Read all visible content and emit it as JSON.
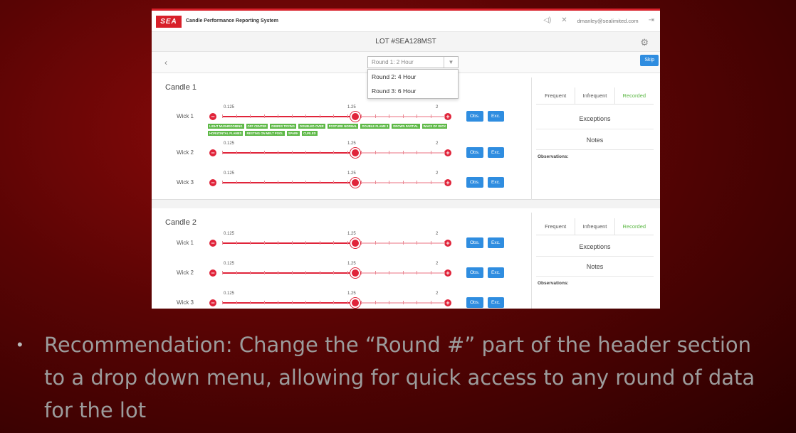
{
  "app": {
    "logo": "SEA",
    "name": "Candle Performance Reporting System",
    "user_email": "dmanley@sealimited.com"
  },
  "lot": {
    "title": "LOT #SEA128MST",
    "skip_label": "Skip"
  },
  "round_select": {
    "selected": "Round 1: 2 Hour",
    "options": [
      "Round 2: 4 Hour",
      "Round 3: 6 Hour"
    ]
  },
  "scale": {
    "min": "0.125",
    "mid": "1.25",
    "max": "2"
  },
  "buttons": {
    "obs": "Obs.",
    "exc": "Exc."
  },
  "candles": [
    {
      "title": "Candle 1",
      "wicks": [
        {
          "label": "Wick 1",
          "value": 1.25
        },
        {
          "label": "Wick 2",
          "value": 1.25
        },
        {
          "label": "Wick 3",
          "value": 1.25
        }
      ],
      "tags": [
        "LIGHT MUSHROOMING",
        "OFF CENTER",
        "DEBRIS TRYING",
        "DOUBLED OVER",
        "POSTURE NORMAL",
        "DOUBLE FLAME 3",
        "DROWN PARTIAL",
        "WAKS OF WICK",
        "HORIZONTAL FLAMES",
        "RESTING ON MELT POOL",
        "SPARK",
        "CURLED"
      ],
      "tabs": [
        "Frequent",
        "Infrequent",
        "Recorded"
      ],
      "exceptions_label": "Exceptions",
      "notes_label": "Notes",
      "observations_label": "Observations:"
    },
    {
      "title": "Candle 2",
      "wicks": [
        {
          "label": "Wick 1",
          "value": 1.25
        },
        {
          "label": "Wick 2",
          "value": 1.25
        },
        {
          "label": "Wick 3",
          "value": 1.25
        }
      ],
      "tabs": [
        "Frequent",
        "Infrequent",
        "Recorded"
      ],
      "exceptions_label": "Exceptions",
      "notes_label": "Notes",
      "observations_label": "Observations:"
    }
  ],
  "slide": {
    "bullet": "•",
    "recommendation": "Recommendation: Change the “Round #” part of the header section to a drop down menu, allowing for quick access to any round of data for the lot"
  },
  "colors": {
    "accent": "#e0243a",
    "button": "#2f8de0",
    "tag": "#5cb845"
  }
}
